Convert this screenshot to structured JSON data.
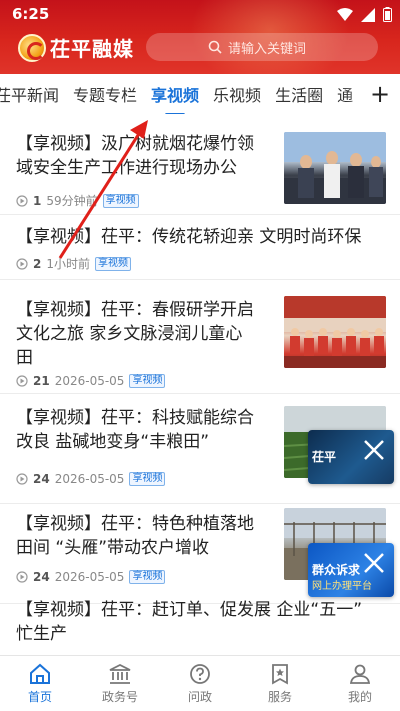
{
  "status": {
    "time": "6:25"
  },
  "header": {
    "logo_text": "茌平融媒",
    "search_placeholder": "请输入关键词"
  },
  "tabs": [
    {
      "label": "茌平新闻",
      "active": false
    },
    {
      "label": "专题专栏",
      "active": false
    },
    {
      "label": "享视频",
      "active": true
    },
    {
      "label": "乐视频",
      "active": false
    },
    {
      "label": "生活圈",
      "active": false
    },
    {
      "label": "通",
      "active": false
    }
  ],
  "tab_plus": "+",
  "feed": [
    {
      "title_l1": "【享视频】汲广树就烟花爆竹领",
      "title_l2": "域安全生产工作进行现场办公",
      "title_l3": "",
      "count": "1",
      "time": "59分钟前",
      "tag": "享视频"
    },
    {
      "title_l1": "【享视频】茌平：传统花轿迎亲  文明时尚环保",
      "title_l2": "",
      "title_l3": "",
      "count": "2",
      "time": "1小时前",
      "tag": "享视频"
    },
    {
      "title_l1": "【享视频】茌平：春假研学开启",
      "title_l2": "文化之旅  家乡文脉浸润儿童心",
      "title_l3": "田",
      "count": "21",
      "time": "2026-05-05",
      "tag": "享视频"
    },
    {
      "title_l1": "【享视频】茌平：科技赋能综合",
      "title_l2": "改良  盐碱地变身“丰粮田”",
      "title_l3": "",
      "count": "24",
      "time": "2026-05-05",
      "tag": "享视频"
    },
    {
      "title_l1": "【享视频】茌平：特色种植落地",
      "title_l2": "田间  “头雁”带动农户增收",
      "title_l3": "",
      "count": "24",
      "time": "2026-05-05",
      "tag": "享视频"
    },
    {
      "title_l1": "【享视频】茌平：赶订单、促发展  企业“五一”",
      "title_l2": "忙生产",
      "title_l3": "",
      "count": "",
      "time": "",
      "tag": ""
    }
  ],
  "float_cards": [
    {
      "text": "茌平",
      "sub": ""
    },
    {
      "text": "群众诉求",
      "sub": "网上办理平台"
    }
  ],
  "bottom_nav": [
    {
      "label": "首页",
      "icon": "home-icon",
      "active": true
    },
    {
      "label": "政务号",
      "icon": "government-icon",
      "active": false
    },
    {
      "label": "问政",
      "icon": "question-icon",
      "active": false
    },
    {
      "label": "服务",
      "icon": "service-star-icon",
      "active": false
    },
    {
      "label": "我的",
      "icon": "user-icon",
      "active": false
    }
  ],
  "colors": {
    "brand_red": "#d8261d",
    "accent_blue": "#1a73d9"
  }
}
